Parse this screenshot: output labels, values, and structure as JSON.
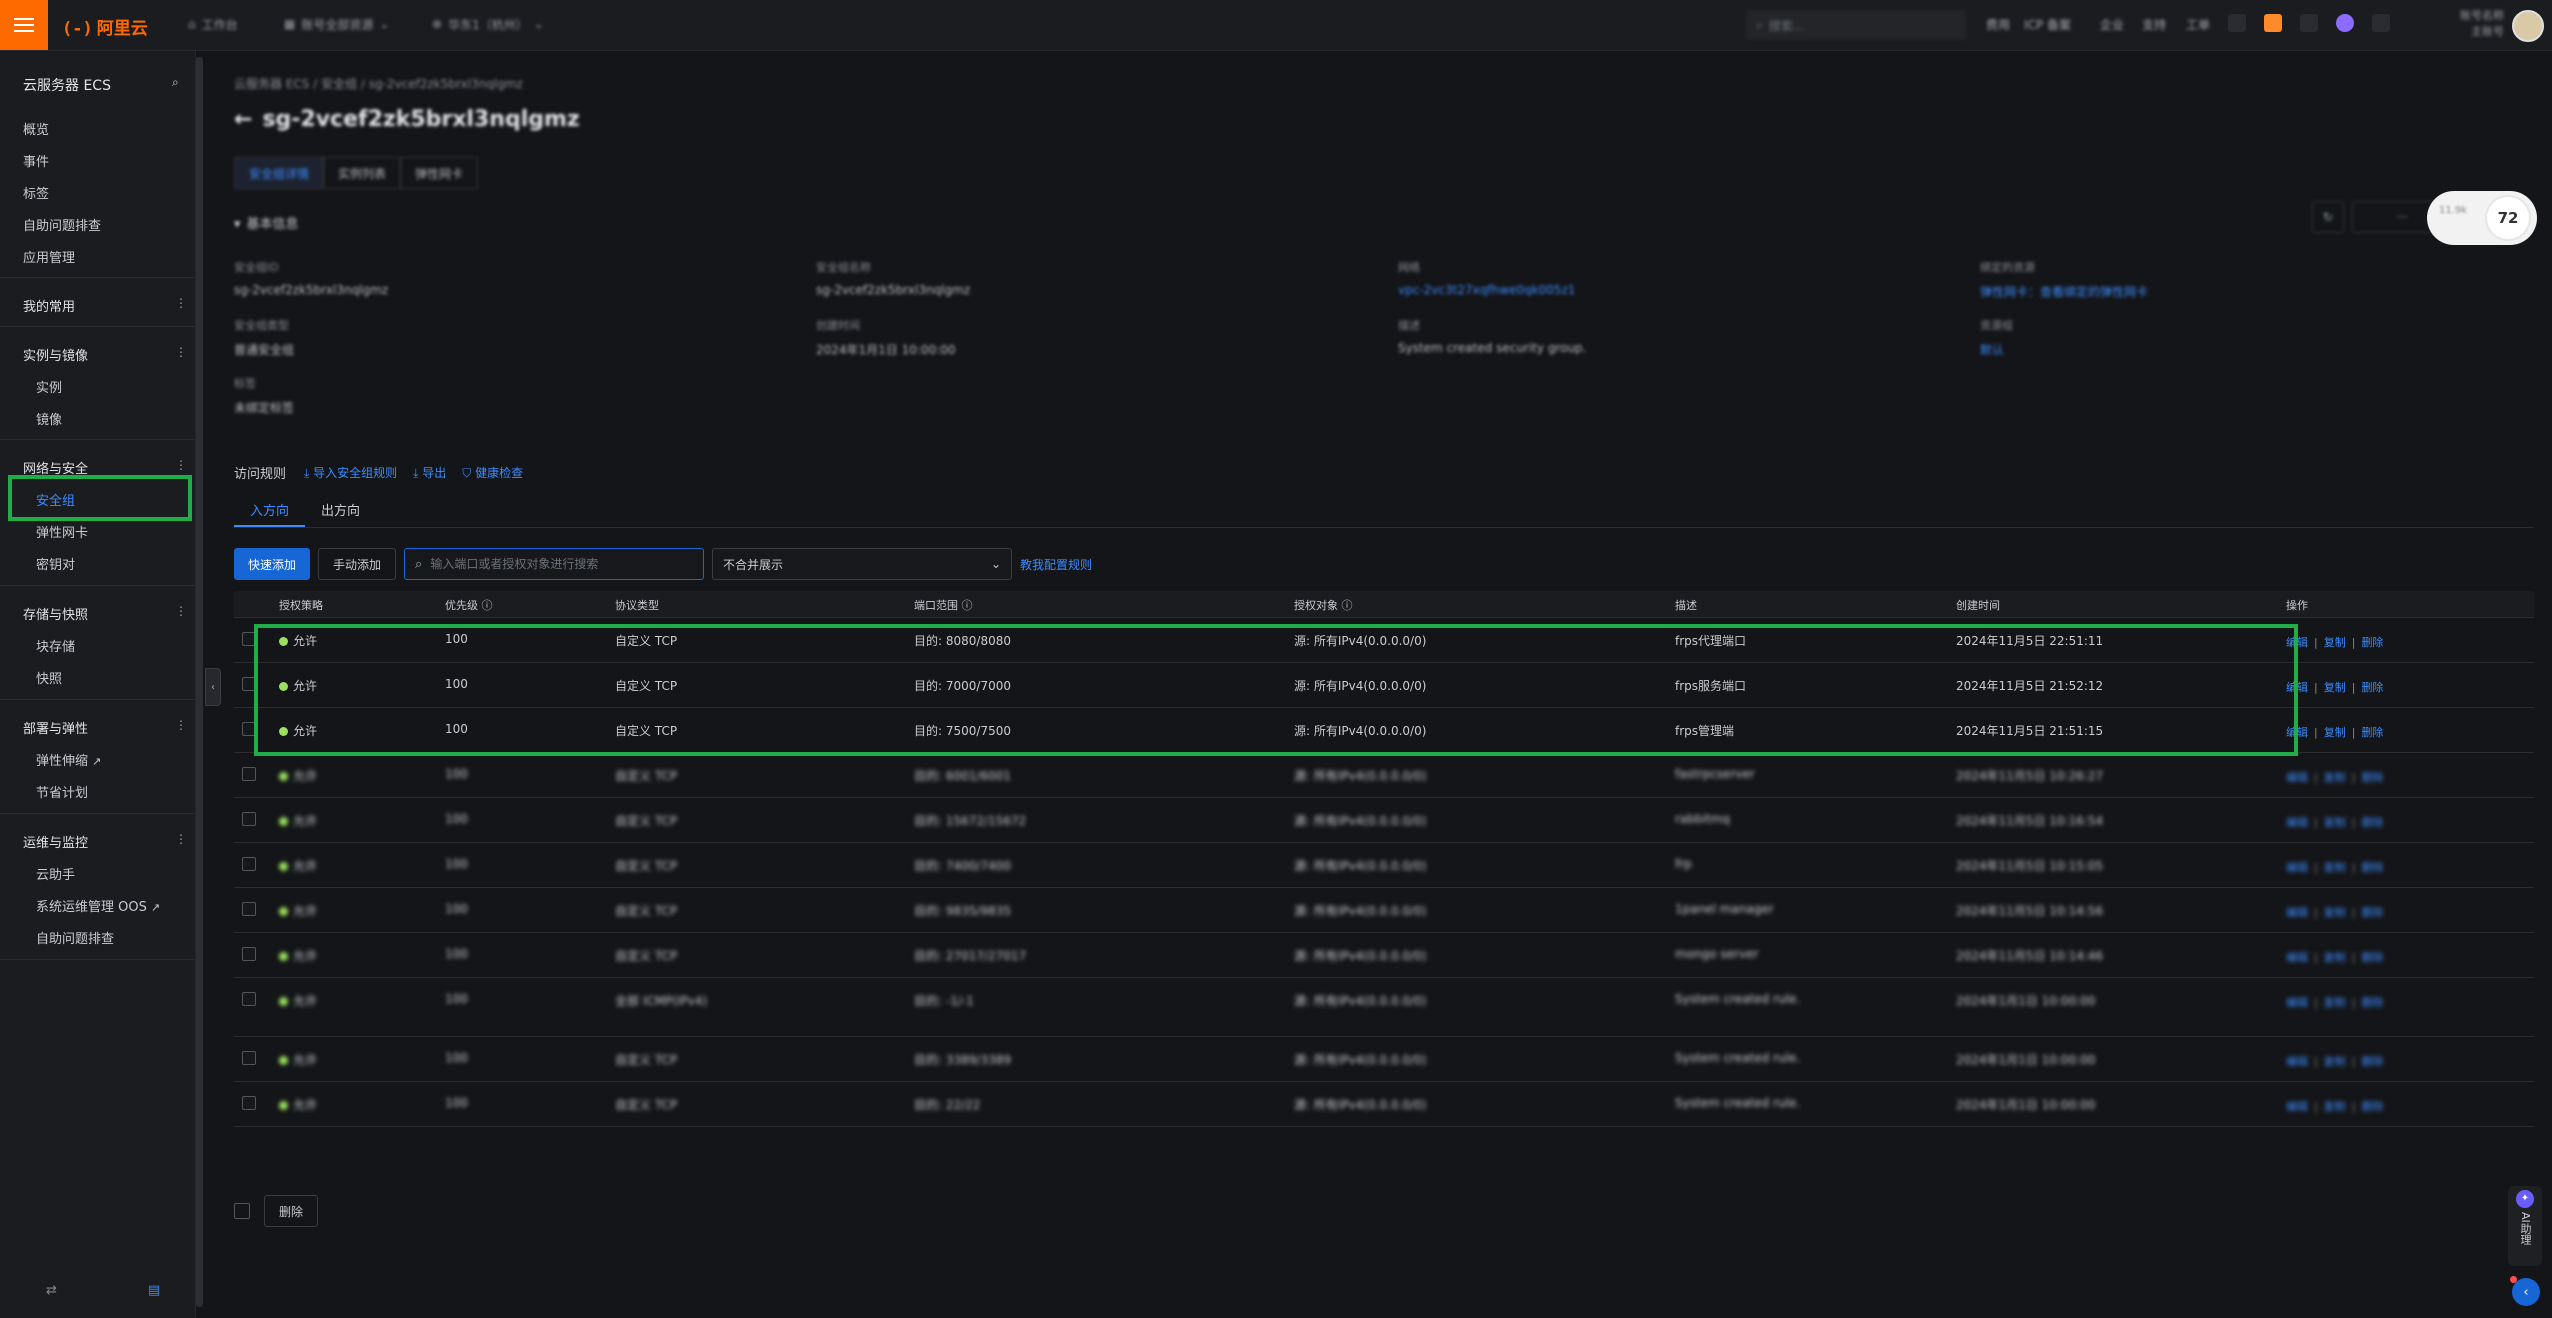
{
  "topbar": {
    "logo_text": "阿里云",
    "logo_symbol": "(-)",
    "tabs": [
      {
        "label": "工作台",
        "icon": "home-icon"
      },
      {
        "label": "账号全部资源",
        "icon": "grid-icon"
      },
      {
        "label": "华东1（杭州）",
        "icon": "globe-icon"
      }
    ],
    "search_placeholder": "搜索...",
    "links": [
      "费用",
      "ICP 备案",
      "企业",
      "支持",
      "工单"
    ],
    "user": {
      "line1": "账号名称",
      "line2": "主账号"
    }
  },
  "sidebar": {
    "title": "云服务器 ECS",
    "top_items": [
      "概览",
      "事件",
      "标签",
      "自助问题排查",
      "应用管理"
    ],
    "groups": [
      {
        "label": "我的常用",
        "items": []
      },
      {
        "label": "实例与镜像",
        "items": [
          "实例",
          "镜像"
        ]
      },
      {
        "label": "网络与安全",
        "items": [
          "安全组",
          "弹性网卡",
          "密钥对"
        ]
      },
      {
        "label": "存储与快照",
        "items": [
          "块存储",
          "快照"
        ]
      },
      {
        "label": "部署与弹性",
        "items": [
          "弹性伸缩",
          "节省计划"
        ]
      },
      {
        "label": "运维与监控",
        "items": [
          "云助手",
          "系统运维管理 OOS",
          "自助问题排查"
        ]
      }
    ],
    "bottom_left_icon": "switch-icon",
    "bottom_right_icon": "layout-icon"
  },
  "main": {
    "breadcrumb": "云服务器 ECS / 安全组 / sg-2vcef2zk5brxl3nqlgmz",
    "title": "sg-2vcef2zk5brxl3nqlgmz",
    "back_icon": "arrow-left-icon",
    "detail_tabs": [
      "安全组详情",
      "实例列表",
      "弹性网卡"
    ],
    "section_title": "基本信息",
    "badge": {
      "left": "11.9k",
      "right": "72"
    },
    "info": [
      {
        "label": "安全组ID",
        "value": "sg-2vcef2zk5brxl3nqlgmz"
      },
      {
        "label": "安全组名称",
        "value": "sg-2vcef2zk5brxl3nqlgmz"
      },
      {
        "label": "网络",
        "value": "vpc-2vc3t27xqfhwe0qk005z1",
        "link": true
      },
      {
        "label": "绑定的资源",
        "value": "弹性网卡：查看绑定的弹性网卡",
        "link": true
      },
      {
        "label": "安全组类型",
        "value": "普通安全组"
      },
      {
        "label": "创建时间",
        "value": "2024年1月1日 10:00:00"
      },
      {
        "label": "描述",
        "value": "System created security group."
      },
      {
        "label": "资源组",
        "value": "默认",
        "link": true
      },
      {
        "label": "标签",
        "value": "未绑定标签"
      }
    ],
    "rules": {
      "title": "访问规则",
      "actions": [
        "导入安全组规则",
        "导出",
        "健康检查"
      ],
      "direction_tabs": [
        "入方向",
        "出方向"
      ],
      "quick_add": "快速添加",
      "manual_add": "手动添加",
      "search_placeholder": "输入端口或者授权对象进行搜索",
      "merge_select": "不合并展示",
      "teach_link": "教我配置规则",
      "columns": [
        "授权策略",
        "优先级",
        "协议类型",
        "端口范围",
        "授权对象",
        "描述",
        "创建时间",
        "操作"
      ],
      "op_labels": [
        "编辑",
        "复制",
        "删除"
      ],
      "rows": [
        {
          "policy": "允许",
          "priority": "100",
          "protocol": "自定义 TCP",
          "port": "目的: 8080/8080",
          "object": "源: 所有IPv4(0.0.0.0/0)",
          "desc": "frps代理端口",
          "time": "2024年11月5日 22:51:11"
        },
        {
          "policy": "允许",
          "priority": "100",
          "protocol": "自定义 TCP",
          "port": "目的: 7000/7000",
          "object": "源: 所有IPv4(0.0.0.0/0)",
          "desc": "frps服务端口",
          "time": "2024年11月5日 21:52:12"
        },
        {
          "policy": "允许",
          "priority": "100",
          "protocol": "自定义 TCP",
          "port": "目的: 7500/7500",
          "object": "源: 所有IPv4(0.0.0.0/0)",
          "desc": "frps管理端",
          "time": "2024年11月5日 21:51:15"
        },
        {
          "policy": "允许",
          "priority": "100",
          "protocol": "自定义 TCP",
          "port": "目的: 6001/6001",
          "object": "源: 所有IPv4(0.0.0.0/0)",
          "desc": "fastrpcserver",
          "time": "2024年11月5日 10:26:27"
        },
        {
          "policy": "允许",
          "priority": "100",
          "protocol": "自定义 TCP",
          "port": "目的: 15672/15672",
          "object": "源: 所有IPv4(0.0.0.0/0)",
          "desc": "rabbitmq",
          "time": "2024年11月5日 10:16:54"
        },
        {
          "policy": "允许",
          "priority": "100",
          "protocol": "自定义 TCP",
          "port": "目的: 7400/7400",
          "object": "源: 所有IPv4(0.0.0.0/0)",
          "desc": "frp",
          "time": "2024年11月5日 10:15:05"
        },
        {
          "policy": "允许",
          "priority": "100",
          "protocol": "自定义 TCP",
          "port": "目的: 9835/9835",
          "object": "源: 所有IPv4(0.0.0.0/0)",
          "desc": "1panel manager",
          "time": "2024年11月5日 10:14:56"
        },
        {
          "policy": "允许",
          "priority": "100",
          "protocol": "自定义 TCP",
          "port": "目的: 27017/27017",
          "object": "源: 所有IPv4(0.0.0.0/0)",
          "desc": "mongo server",
          "time": "2024年11月5日 10:14:46"
        },
        {
          "policy": "允许",
          "priority": "100",
          "protocol": "全部 ICMP(IPv4)",
          "port": "目的: -1/-1",
          "object": "源: 所有IPv4(0.0.0.0/0)",
          "desc": "System created rule.",
          "time": "2024年1月1日 10:00:00"
        },
        {
          "policy": "允许",
          "priority": "100",
          "protocol": "自定义 TCP",
          "port": "目的: 3389/3389",
          "object": "源: 所有IPv4(0.0.0.0/0)",
          "desc": "System created rule.",
          "time": "2024年1月1日 10:00:00"
        },
        {
          "policy": "允许",
          "priority": "100",
          "protocol": "自定义 TCP",
          "port": "目的: 22/22",
          "object": "源: 所有IPv4(0.0.0.0/0)",
          "desc": "System created rule.",
          "time": "2024年1月1日 10:00:00"
        }
      ],
      "bulk_delete": "删除"
    }
  },
  "assistant": {
    "label": "AI助理"
  },
  "colors": {
    "accent": "#3b8cff",
    "brand": "#ff6a00",
    "highlight": "#1fad48",
    "allow_dot": "#9be15d"
  }
}
